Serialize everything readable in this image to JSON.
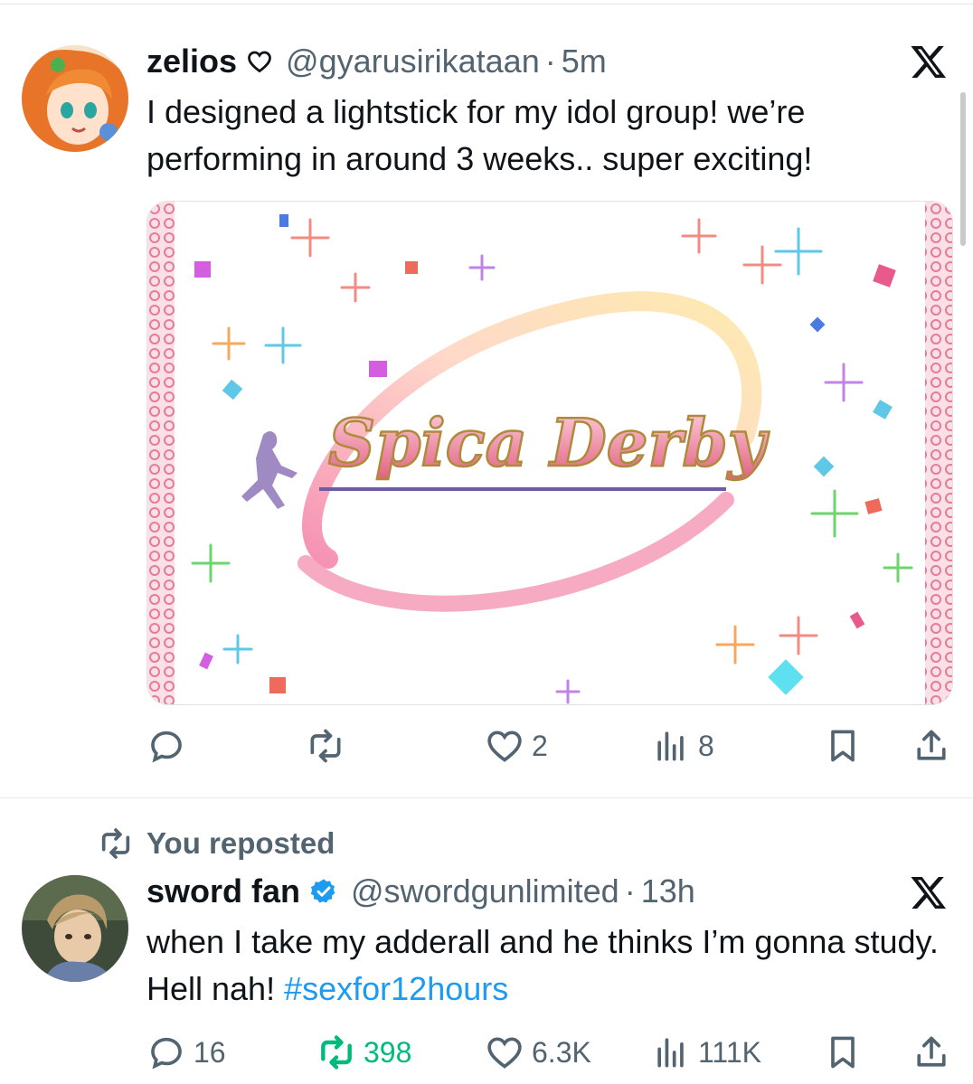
{
  "posts": [
    {
      "author_name": "zelios",
      "author_handle": "@gyarusirikataan",
      "separator": "·",
      "time": "5m",
      "text": "I designed a lightstick for my idol group! we’re performing in around 3 weeks.. super exciting!",
      "image_title": "Spica Derby",
      "stats": {
        "reply": "",
        "repost": "",
        "like": "2",
        "views": "8"
      }
    },
    {
      "repost_label": "You reposted",
      "author_name": "sword fan",
      "author_handle": "@swordgunlimited",
      "separator": "·",
      "time": "13h",
      "text_main": "when I take my adderall and he thinks I’m gonna study. Hell nah! ",
      "hashtag": "#sexfor12hours",
      "stats": {
        "reply": "16",
        "repost": "398",
        "like": "6.3K",
        "views": "111K"
      }
    }
  ],
  "colors": {
    "accent": "#1d9bf0",
    "repost_active": "#00ba7c",
    "muted": "#536471",
    "text": "#0f1419"
  }
}
